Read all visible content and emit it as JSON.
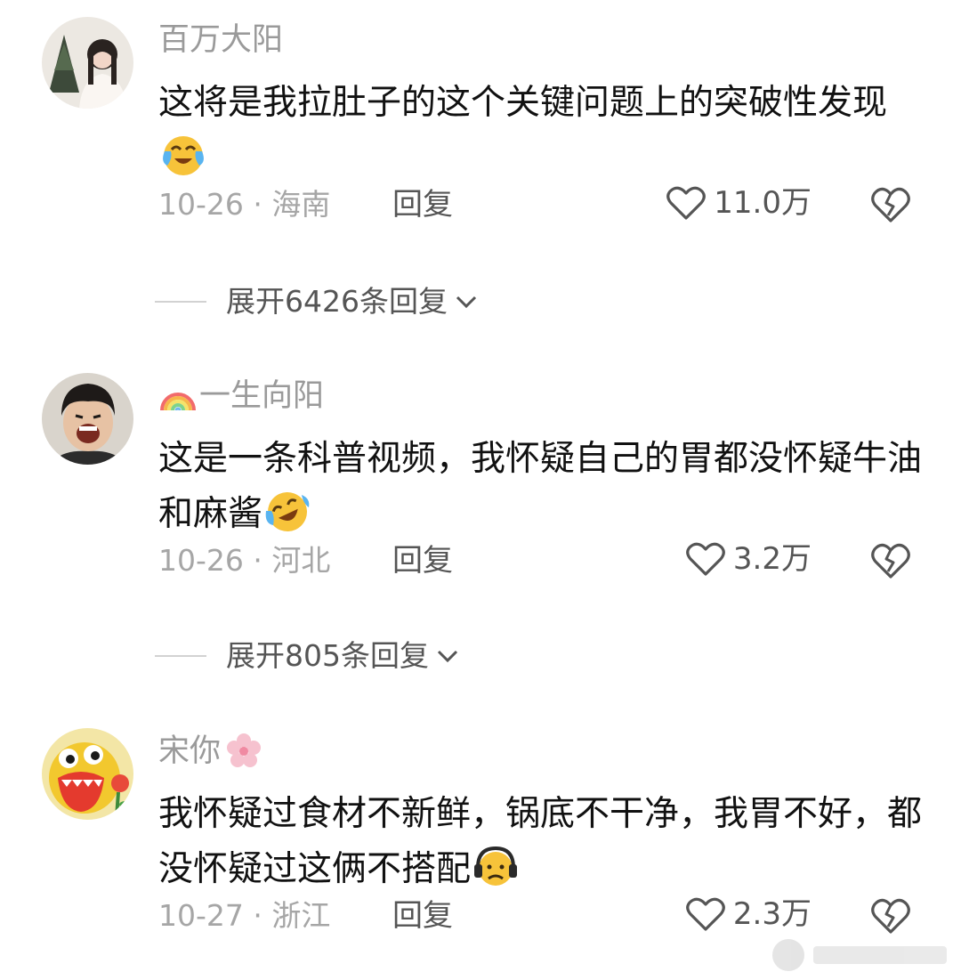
{
  "comments": [
    {
      "username": "百万大阳",
      "text": "这将是我拉肚子的这个关键问题上的突破性发现",
      "text_emoji": "crying-laughing-emoji",
      "date": "10-26",
      "location": "海南",
      "reply_label": "回复",
      "like_count": "11.0万",
      "expand_label": "展开6426条回复"
    },
    {
      "username": "一生向阳",
      "name_emoji": "rainbow-emoji",
      "text": "这是一条科普视频，我怀疑自己的胃都没怀疑牛油和麻酱",
      "text_emoji": "rofl-emoji",
      "date": "10-26",
      "location": "河北",
      "reply_label": "回复",
      "like_count": "3.2万",
      "expand_label": "展开805条回复"
    },
    {
      "username": "宋你",
      "name_emoji": "cherry-blossom-emoji",
      "text": "我怀疑过食材不新鲜，锅底不干净，我胃不好，都没怀疑过这俩不搭配",
      "text_emoji": "headphones-frown-emoji",
      "date": "10-27",
      "location": "浙江",
      "reply_label": "回复",
      "like_count": "2.3万"
    }
  ],
  "separator": "·",
  "colors": {
    "text": "#111111",
    "meta": "#a6a6a6",
    "secondary": "#555555",
    "divider": "#d2d2d2"
  }
}
